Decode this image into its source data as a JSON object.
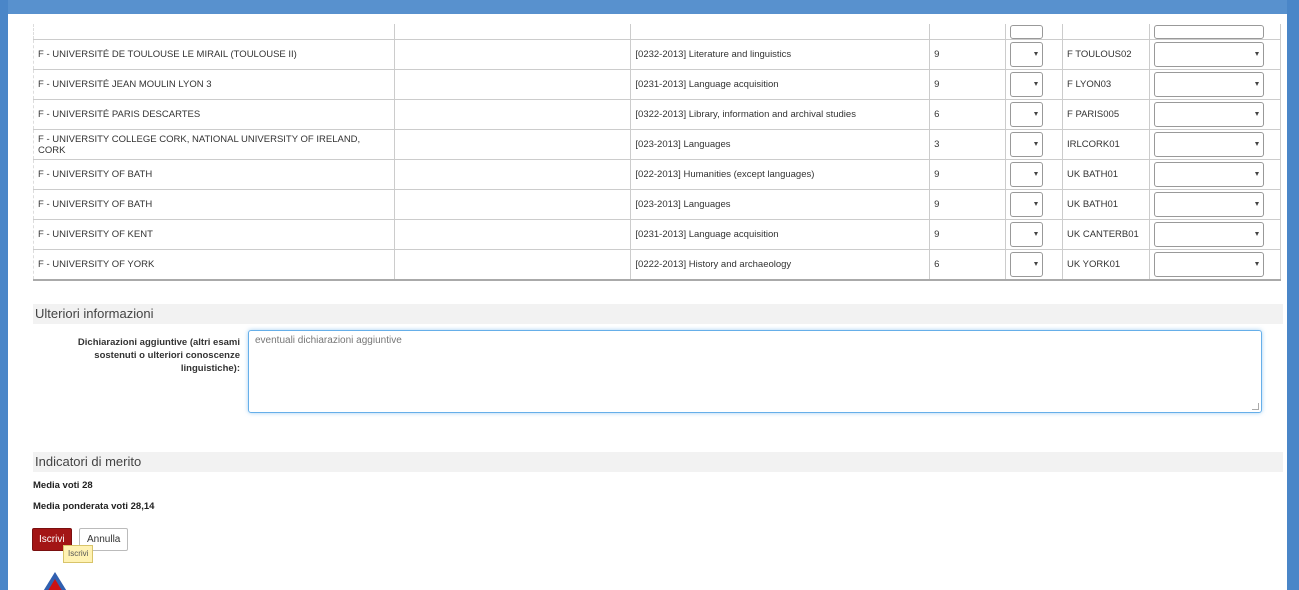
{
  "table": {
    "rows": [
      {
        "university": "F - UNIVERSITÉ DE TOULOUSE LE MIRAIL (TOULOUSE II)",
        "area": "[0232-2013] Literature and linguistics",
        "months": "9",
        "code": "F TOULOUS02"
      },
      {
        "university": "F - UNIVERSITÉ JEAN MOULIN LYON 3",
        "area": "[0231-2013] Language acquisition",
        "months": "9",
        "code": "F LYON03"
      },
      {
        "university": "F - UNIVERSITÉ PARIS DESCARTES",
        "area": "[0322-2013] Library, information and archival studies",
        "months": "6",
        "code": "F PARIS005"
      },
      {
        "university": "F - UNIVERSITY COLLEGE CORK, NATIONAL UNIVERSITY OF IRELAND, CORK",
        "area": "[023-2013] Languages",
        "months": "3",
        "code": "IRLCORK01"
      },
      {
        "university": "F - UNIVERSITY OF BATH",
        "area": "[022-2013] Humanities (except languages)",
        "months": "9",
        "code": "UK BATH01"
      },
      {
        "university": "F - UNIVERSITY OF BATH",
        "area": "[023-2013] Languages",
        "months": "9",
        "code": "UK BATH01"
      },
      {
        "university": "F - UNIVERSITY OF KENT",
        "area": "[0231-2013] Language acquisition",
        "months": "9",
        "code": "UK CANTERB01"
      },
      {
        "university": "F - UNIVERSITY OF YORK",
        "area": "[0222-2013] History and archaeology",
        "months": "6",
        "code": "UK YORK01"
      }
    ]
  },
  "ulteriori": {
    "title": "Ulteriori informazioni",
    "label": "Dichiarazioni aggiuntive (altri esami sostenuti o ulteriori conoscenze linguistiche):",
    "value": "eventuali dichiarazioni aggiuntive"
  },
  "merito": {
    "title": "Indicatori di merito",
    "media": "Media voti 28",
    "media_ponderata": "Media ponderata voti 28,14"
  },
  "buttons": {
    "submit": "Iscrivi",
    "cancel": "Annulla",
    "tooltip": "Iscrivi"
  },
  "colors": {
    "frame": "#4a86c8",
    "primary": "#a31515",
    "tooltip": "#fff2b3"
  }
}
